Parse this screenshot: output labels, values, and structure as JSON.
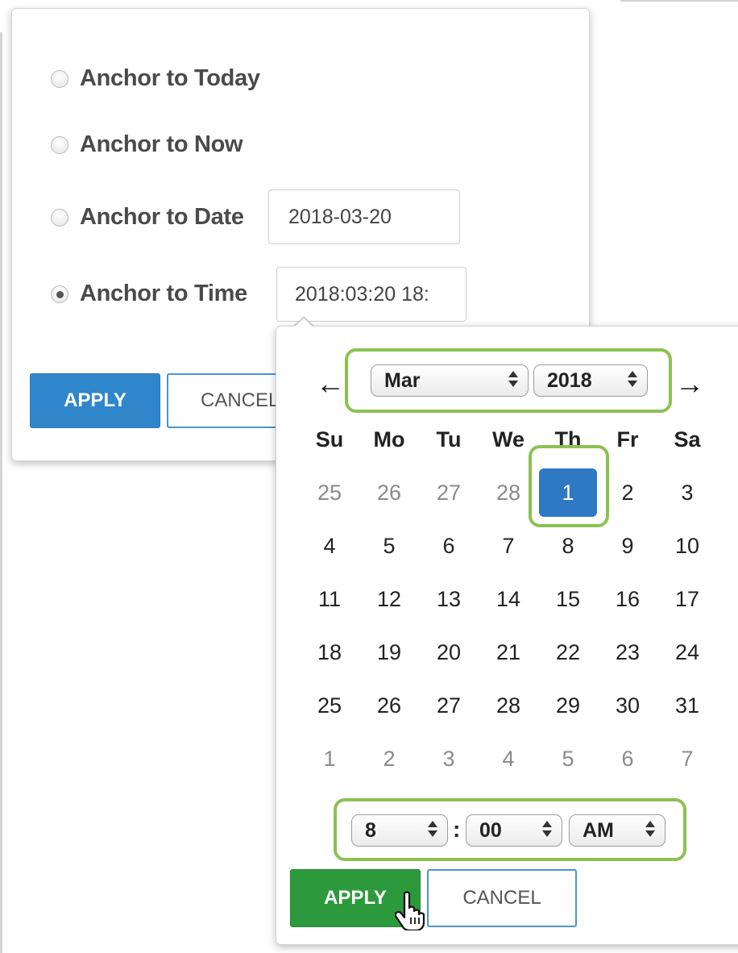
{
  "anchor_options": [
    {
      "label": "Anchor to Today",
      "checked": false
    },
    {
      "label": "Anchor to Now",
      "checked": false
    },
    {
      "label": "Anchor to Date",
      "checked": false
    },
    {
      "label": "Anchor to Time",
      "checked": true
    }
  ],
  "date_field": {
    "value": "2018-03-20"
  },
  "time_field": {
    "value": "2018:03:20 18:"
  },
  "panel_buttons": {
    "apply": "APPLY",
    "cancel": "CANCEL"
  },
  "calendar": {
    "prev_icon": "arrow-left-icon",
    "next_icon": "arrow-right-icon",
    "month": "Mar",
    "year": "2018",
    "weekdays": [
      "Su",
      "Mo",
      "Tu",
      "We",
      "Th",
      "Fr",
      "Sa"
    ],
    "weeks": [
      [
        "25",
        "26",
        "27",
        "28",
        "1",
        "2",
        "3"
      ],
      [
        "4",
        "5",
        "6",
        "7",
        "8",
        "9",
        "10"
      ],
      [
        "11",
        "12",
        "13",
        "14",
        "15",
        "16",
        "17"
      ],
      [
        "18",
        "19",
        "20",
        "21",
        "22",
        "23",
        "24"
      ],
      [
        "25",
        "26",
        "27",
        "28",
        "29",
        "30",
        "31"
      ],
      [
        "1",
        "2",
        "3",
        "4",
        "5",
        "6",
        "7"
      ]
    ],
    "selected_day": "1"
  },
  "time": {
    "hour": "8",
    "separator": ":",
    "minute": "00",
    "period": "AM"
  },
  "popup_buttons": {
    "apply": "APPLY",
    "cancel": "CANCEL"
  },
  "colors": {
    "accent_blue": "#2f86cb",
    "apply_green": "#2c9a3c",
    "highlight_green": "#8cc152"
  }
}
